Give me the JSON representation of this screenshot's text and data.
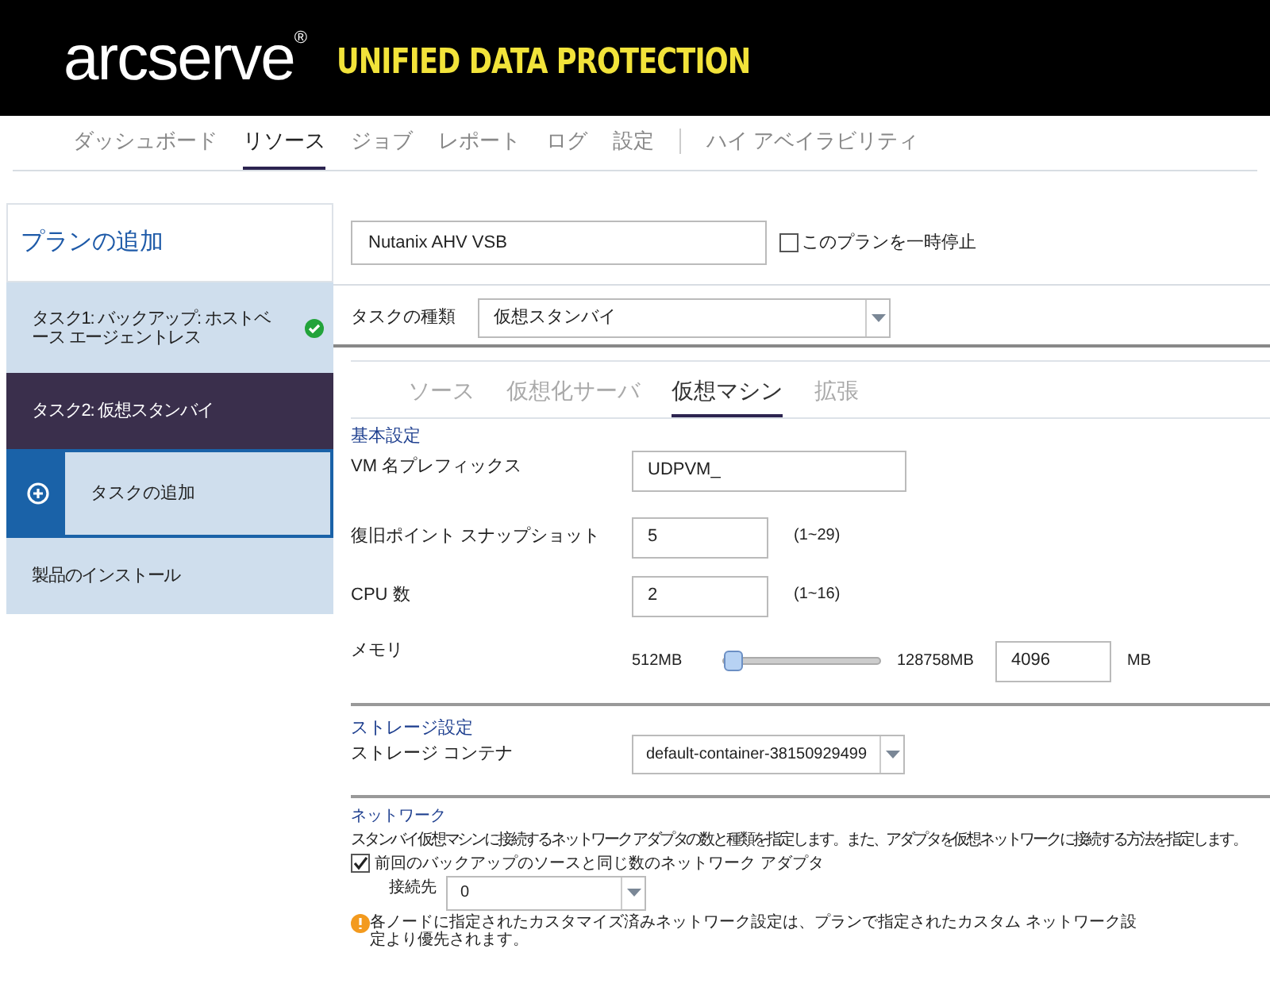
{
  "header": {
    "logo": "arcserve",
    "logo_mark": "®",
    "product": "UNIFIED DATA PROTECTION"
  },
  "nav": [
    {
      "label": "ダッシュボード",
      "selected": false
    },
    {
      "label": "リソース",
      "selected": true
    },
    {
      "label": "ジョブ",
      "selected": false
    },
    {
      "label": "レポート",
      "selected": false
    },
    {
      "label": "ログ",
      "selected": false
    },
    {
      "label": "設定",
      "selected": false
    },
    {
      "label": "ハイ アベイラビリティ",
      "selected": false
    }
  ],
  "sidebar": {
    "title": "プランの追加",
    "items": [
      {
        "kind": "task",
        "label": "タスク1: バックアップ: ホストベース エージェントレス",
        "selected": false,
        "done": true
      },
      {
        "kind": "task",
        "label": "タスク2: 仮想スタンバイ",
        "selected": true,
        "done": false
      },
      {
        "kind": "add",
        "label": "タスクの追加",
        "selected": false
      },
      {
        "kind": "task",
        "label": "製品のインストール",
        "selected": false,
        "done": false
      }
    ]
  },
  "plan": {
    "name": "Nutanix AHV VSB",
    "pause_label": "このプランを一時停止",
    "pause_checked": false
  },
  "task_type": {
    "label": "タスクの種類",
    "value": "仮想スタンバイ"
  },
  "tabs": [
    {
      "label": "ソース",
      "selected": false
    },
    {
      "label": "仮想化サーバ",
      "selected": false
    },
    {
      "label": "仮想マシン",
      "selected": true
    },
    {
      "label": "拡張",
      "selected": false
    }
  ],
  "basic": {
    "heading": "基本設定",
    "fields": [
      {
        "kind": "text",
        "label": "VM 名プレフィックス",
        "value": "UDPVM_"
      },
      {
        "kind": "number",
        "label": "復旧ポイント スナップショット",
        "value": "5",
        "range": "(1~29)"
      },
      {
        "kind": "number",
        "label": "CPU 数",
        "value": "2",
        "range": "(1~16)"
      },
      {
        "kind": "slider",
        "label": "メモリ",
        "min": "512MB",
        "max": "128758MB",
        "level": 0.03,
        "value": "4096",
        "unit": "MB"
      }
    ]
  },
  "storage": {
    "heading": "ストレージ設定",
    "label": "ストレージ コンテナ",
    "value": "default-container-38150929499"
  },
  "network": {
    "heading": "ネットワーク",
    "description": "スタンバイ仮想マシンに接続するネットワーク アダプタの数と種類を指定します。また、アダプタを仮想ネットワークに接続する方法を指定します。",
    "same_label": "前回のバックアップのソースと同じ数のネットワーク アダプタ",
    "same_checked": true,
    "connect_label": "接続先",
    "connect_value": "0",
    "warning": "各ノードに指定されたカスタマイズ済みネットワーク設定は、プランで指定されたカスタム ネットワーク設定より優先されます。"
  }
}
